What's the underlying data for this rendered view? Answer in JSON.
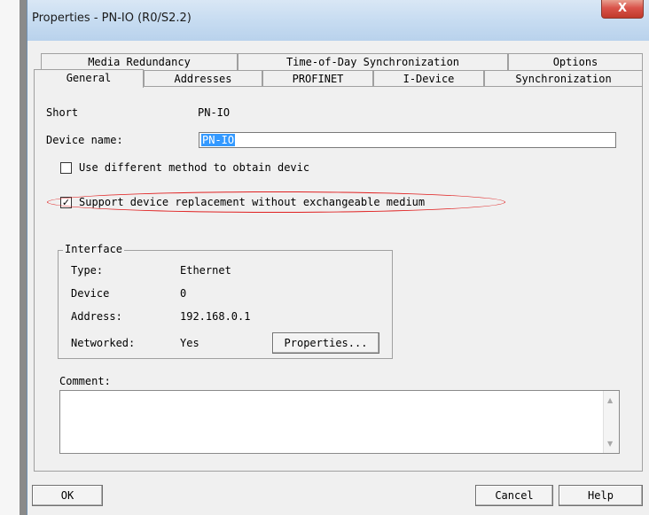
{
  "window": {
    "title": "Properties - PN-IO (R0/S2.2)",
    "close_glyph": "X"
  },
  "tabs": {
    "row1": [
      {
        "label": "Media Redundancy"
      },
      {
        "label": "Time-of-Day Synchronization"
      },
      {
        "label": "Options"
      }
    ],
    "row2": [
      {
        "label": "General",
        "active": true
      },
      {
        "label": "Addresses"
      },
      {
        "label": "PROFINET"
      },
      {
        "label": "I-Device"
      },
      {
        "label": "Synchronization"
      }
    ]
  },
  "general": {
    "short_label": "Short",
    "short_value": "PN-IO",
    "device_name_label": "Device name:",
    "device_name_value": "PN-IO",
    "checkbox_method": {
      "label": "Use different method to obtain devic",
      "checked": false
    },
    "checkbox_replacement": {
      "label": "Support device replacement without exchangeable medium",
      "checked": true,
      "check_glyph": "✓"
    }
  },
  "interface": {
    "title": "Interface",
    "type_label": "Type:",
    "type_value": "Ethernet",
    "device_label": "Device",
    "device_value": "0",
    "address_label": "Address:",
    "address_value": "192.168.0.1",
    "networked_label": "Networked:",
    "networked_value": "Yes",
    "properties_button": "Properties..."
  },
  "comment": {
    "label": "Comment:",
    "value": ""
  },
  "footer": {
    "ok": "OK",
    "cancel": "Cancel",
    "help": "Help"
  },
  "colors": {
    "highlight_ellipse": "#e02020",
    "selection": "#3399ff",
    "close_button": "#c0392b"
  },
  "icons": {
    "close": "close-icon",
    "scroll_up": "scroll-up-icon",
    "scroll_down": "scroll-down-icon",
    "checkmark": "checkmark-icon"
  }
}
